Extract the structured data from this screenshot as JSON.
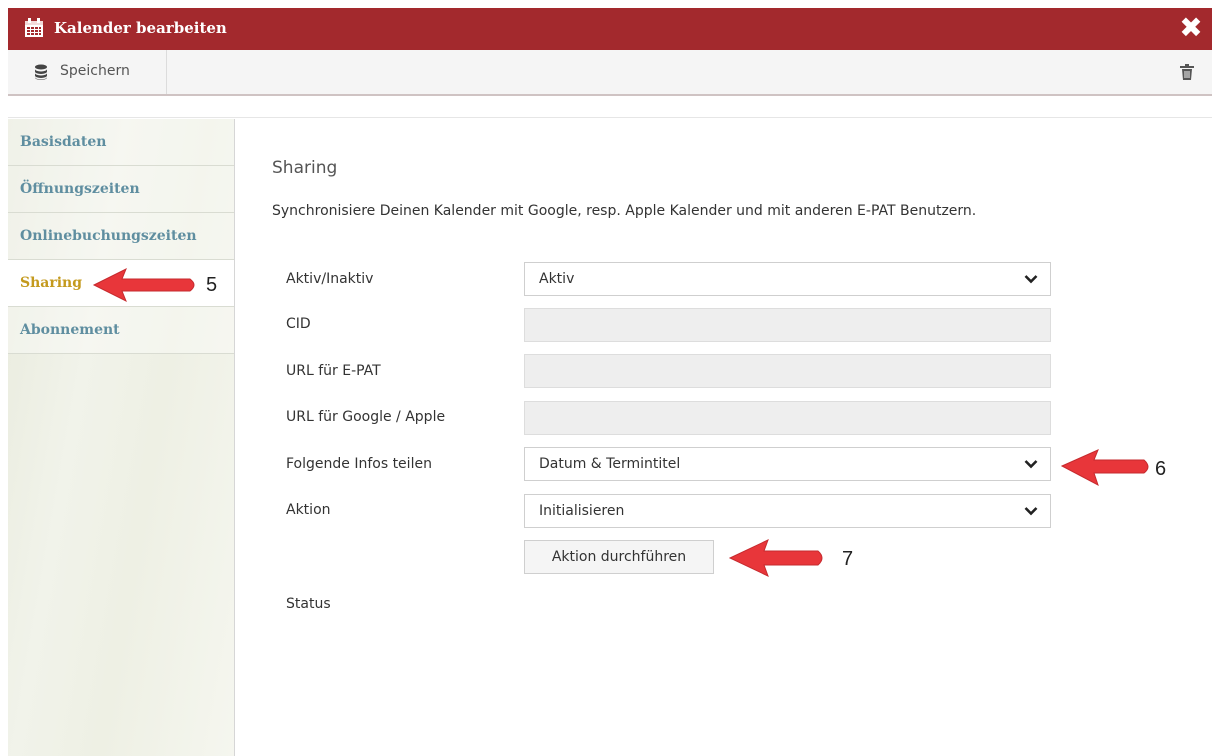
{
  "window": {
    "title": "Kalender bearbeiten",
    "close_glyph": "✖",
    "accent_color": "#a3292d"
  },
  "toolbar": {
    "save_label": "Speichern",
    "save_icon": "database-icon",
    "delete_icon": "trash-icon"
  },
  "sidebar": {
    "items": [
      {
        "label": "Basisdaten",
        "active": false
      },
      {
        "label": "Öffnungszeiten",
        "active": false
      },
      {
        "label": "Onlinebuchungszeiten",
        "active": false
      },
      {
        "label": "Sharing",
        "active": true
      },
      {
        "label": "Abonnement",
        "active": false
      }
    ],
    "active_color": "#c49a1e",
    "item_color": "#5f8ea0"
  },
  "main": {
    "section_title": "Sharing",
    "description": "Synchronisiere Deinen Kalender mit Google, resp. Apple Kalender und mit anderen E-PAT Benutzern.",
    "fields": {
      "active": {
        "label": "Aktiv/Inaktiv",
        "value": "Aktiv"
      },
      "cid": {
        "label": "CID",
        "value": ""
      },
      "url_epat": {
        "label": "URL für E-PAT",
        "value": ""
      },
      "url_google": {
        "label": "URL für Google / Apple",
        "value": ""
      },
      "share_info": {
        "label": "Folgende Infos teilen",
        "value": "Datum & Termintitel"
      },
      "action": {
        "label": "Aktion",
        "value": "Initialisieren"
      }
    },
    "action_button": "Aktion durchführen",
    "status_label": "Status"
  },
  "annotations": {
    "arrow_color": "#e8363a",
    "items": [
      {
        "number": "5"
      },
      {
        "number": "6"
      },
      {
        "number": "7"
      }
    ]
  }
}
